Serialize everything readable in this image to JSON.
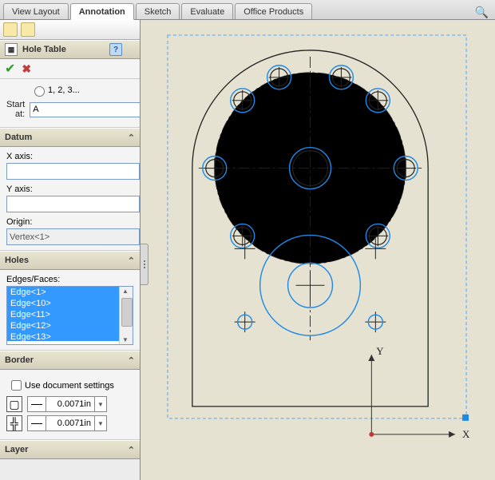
{
  "tabs": {
    "t1": "View Layout",
    "t2": "Annotation",
    "t3": "Sketch",
    "t4": "Evaluate",
    "t5": "Office Products"
  },
  "panelTitle": "Hole Table",
  "help": "?",
  "numbering": {
    "radioLabel": "1, 2, 3...",
    "startLabel": "Start at:",
    "startValue": "A"
  },
  "datum": {
    "title": "Datum",
    "xLabel": "X axis:",
    "xValue": "",
    "yLabel": "Y axis:",
    "yValue": "",
    "originLabel": "Origin:",
    "originValue": "Vertex<1>"
  },
  "holes": {
    "title": "Holes",
    "listLabel": "Edges/Faces:",
    "items": [
      "Edge<1>",
      "Edge<10>",
      "Edge<11>",
      "Edge<12>",
      "Edge<13>"
    ]
  },
  "border": {
    "title": "Border",
    "useDoc": "Use document settings",
    "val1": "0.0071in",
    "val2": "0.0071in"
  },
  "layer": {
    "title": "Layer"
  },
  "axes": {
    "x": "X",
    "y": "Y"
  }
}
